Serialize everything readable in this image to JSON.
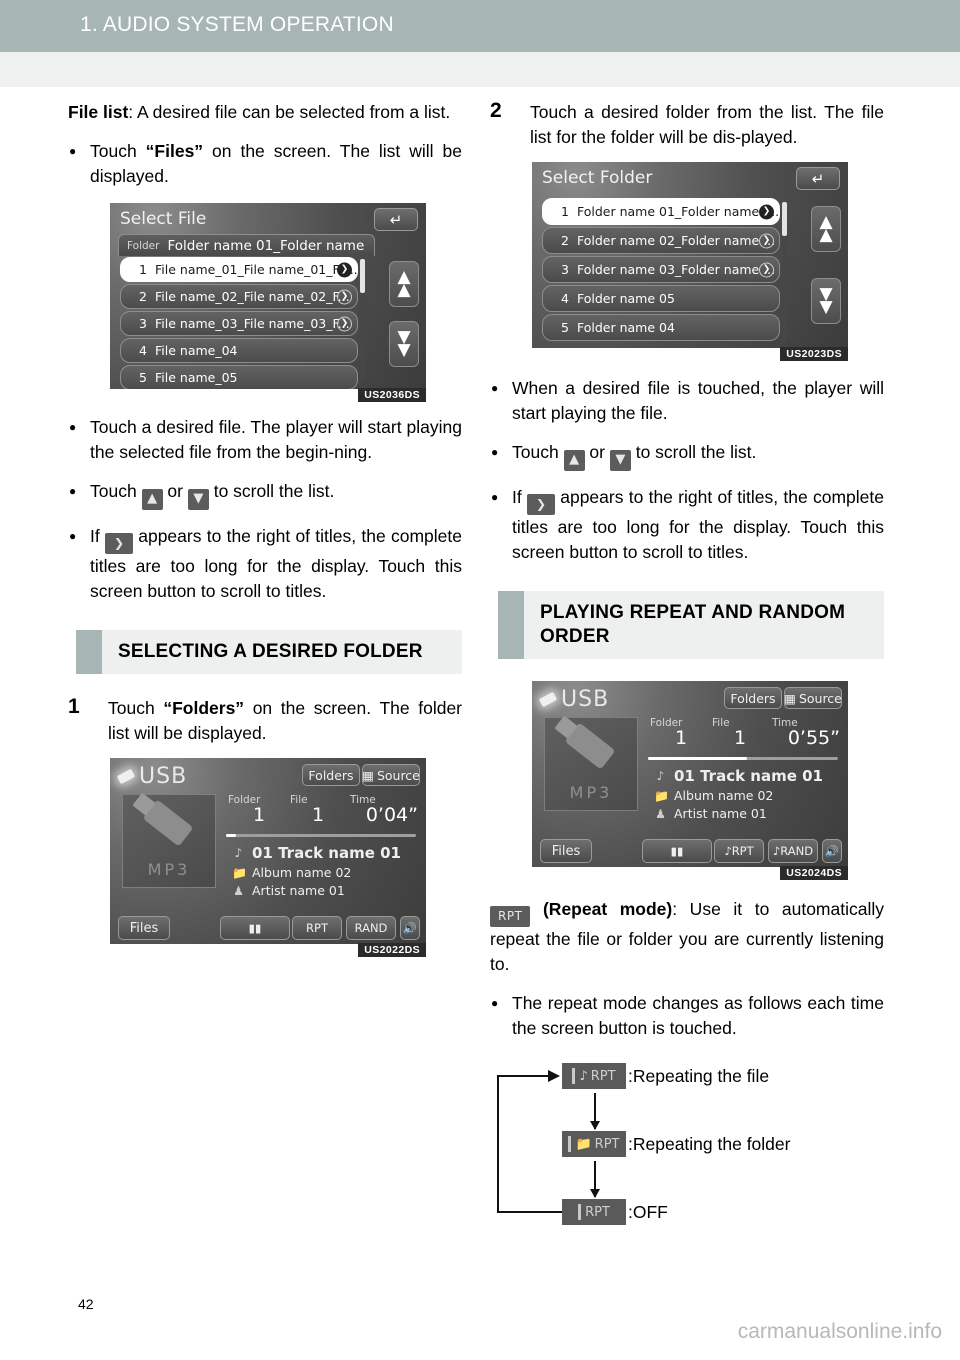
{
  "header": {
    "title": "1. AUDIO SYSTEM OPERATION",
    "band_color": "#a7b5b5"
  },
  "footer": {
    "page_number": "42",
    "watermark": "carmanualsonline.info"
  },
  "left_column": {
    "intro": {
      "bold": "File list",
      "rest": ": A desired file can be selected from a list."
    },
    "bullet_files": {
      "pre": "Touch ",
      "bold": "“Files”",
      "post": " on the screen. The list will be displayed."
    },
    "screenshot_file_list": {
      "caption": "US2036DS",
      "title": "Select File",
      "back_icon": "back-arrow-icon",
      "tab_label": "Folder",
      "tab_value": "Folder name 01_Folder name",
      "rows": [
        {
          "index": "1",
          "name": "File name_01_File name_01_Fil...",
          "has_arrow": true,
          "selected": true
        },
        {
          "index": "2",
          "name": "File name_02_File name_02_F...",
          "has_arrow": true,
          "selected": false
        },
        {
          "index": "3",
          "name": "File name_03_File name_03_F...",
          "has_arrow": true,
          "selected": false
        },
        {
          "index": "4",
          "name": "File name_04",
          "has_arrow": false,
          "selected": false
        },
        {
          "index": "5",
          "name": "File name_05",
          "has_arrow": false,
          "selected": false
        }
      ]
    },
    "bullet_touch_file": "Touch a desired file. The player will start playing the selected file from the begin-ning.",
    "bullet_scroll": {
      "pre": "Touch ",
      "mid": " or ",
      "post": " to scroll the list."
    },
    "bullet_long_titles": {
      "pre": "If ",
      "post": " appears to the right of titles, the complete titles are too long for the display. Touch this screen button to scroll to titles."
    },
    "section_heading": "SELECTING A DESIRED FOLDER",
    "step1": {
      "number": "1",
      "pre": "Touch ",
      "bold": "“Folders”",
      "post": " on the screen. The folder list will be displayed."
    },
    "screenshot_player": {
      "caption": "US2022DS",
      "source_name": "USB",
      "btn_folders": "Folders",
      "btn_source": "Source",
      "art_label": "MP3",
      "labels": {
        "folder": "Folder",
        "file": "File",
        "time": "Time"
      },
      "values": {
        "folder": "1",
        "file": "1",
        "time": "0’04”"
      },
      "progress_percent": 5,
      "track": "01 Track name 01",
      "album": "Album name 02",
      "artist": "Artist name 01",
      "btn_files": "Files",
      "btn_pause": "pause-icon",
      "btn_rpt": "RPT",
      "btn_rand": "RAND",
      "btn_volume": "speaker-icon"
    }
  },
  "right_column": {
    "step2": {
      "number": "2",
      "text": "Touch a desired folder from the list. The file list for the folder will be dis-played."
    },
    "screenshot_folder_list": {
      "caption": "US2023DS",
      "title": "Select Folder",
      "back_icon": "back-arrow-icon",
      "rows": [
        {
          "index": "1",
          "name": "Folder name 01_Folder name 0...",
          "has_arrow": true,
          "selected": true
        },
        {
          "index": "2",
          "name": "Folder name 02_Folder name ...",
          "has_arrow": true,
          "selected": false
        },
        {
          "index": "3",
          "name": "Folder name 03_Folder name ...",
          "has_arrow": true,
          "selected": false
        },
        {
          "index": "4",
          "name": "Folder name 05",
          "has_arrow": false,
          "selected": false
        },
        {
          "index": "5",
          "name": "Folder name 04",
          "has_arrow": false,
          "selected": false
        }
      ]
    },
    "bullet_when_touched": "When a desired file is touched, the player will start playing the file.",
    "bullet_scroll": {
      "pre": "Touch ",
      "mid": " or ",
      "post": " to scroll the list."
    },
    "bullet_long_titles": {
      "pre": "If ",
      "post": " appears to the right of titles, the complete titles are too long for the display. Touch this screen button to scroll to titles."
    },
    "section_heading": "PLAYING REPEAT AND RANDOM ORDER",
    "screenshot_player": {
      "caption": "US2024DS",
      "source_name": "USB",
      "btn_folders": "Folders",
      "btn_source": "Source",
      "art_label": "MP3",
      "labels": {
        "folder": "Folder",
        "file": "File",
        "time": "Time"
      },
      "values": {
        "folder": "1",
        "file": "1",
        "time": "0’55”"
      },
      "progress_percent": 52,
      "track": "01 Track name 01",
      "album": "Album name 02",
      "artist": "Artist name 01",
      "btn_files": "Files",
      "btn_pause": "pause-icon",
      "btn_rpt": "RPT",
      "btn_rand": "RAND",
      "btn_volume": "speaker-icon"
    },
    "repeat_desc": {
      "chip": "RPT",
      "bold": "(Repeat mode)",
      "rest": ": Use it to automatically repeat the file or folder you are currently listening to."
    },
    "bullet_repeat_changes": "The repeat mode changes as follows each time the screen button is touched.",
    "repeat_flow": [
      {
        "chip_icon": "music-note-icon",
        "chip": "RPT",
        "label": ":Repeating the file"
      },
      {
        "chip_icon": "folder-icon",
        "chip": "RPT",
        "label": ":Repeating the folder"
      },
      {
        "chip_icon": "none",
        "chip": "RPT",
        "label": ":OFF"
      }
    ]
  }
}
